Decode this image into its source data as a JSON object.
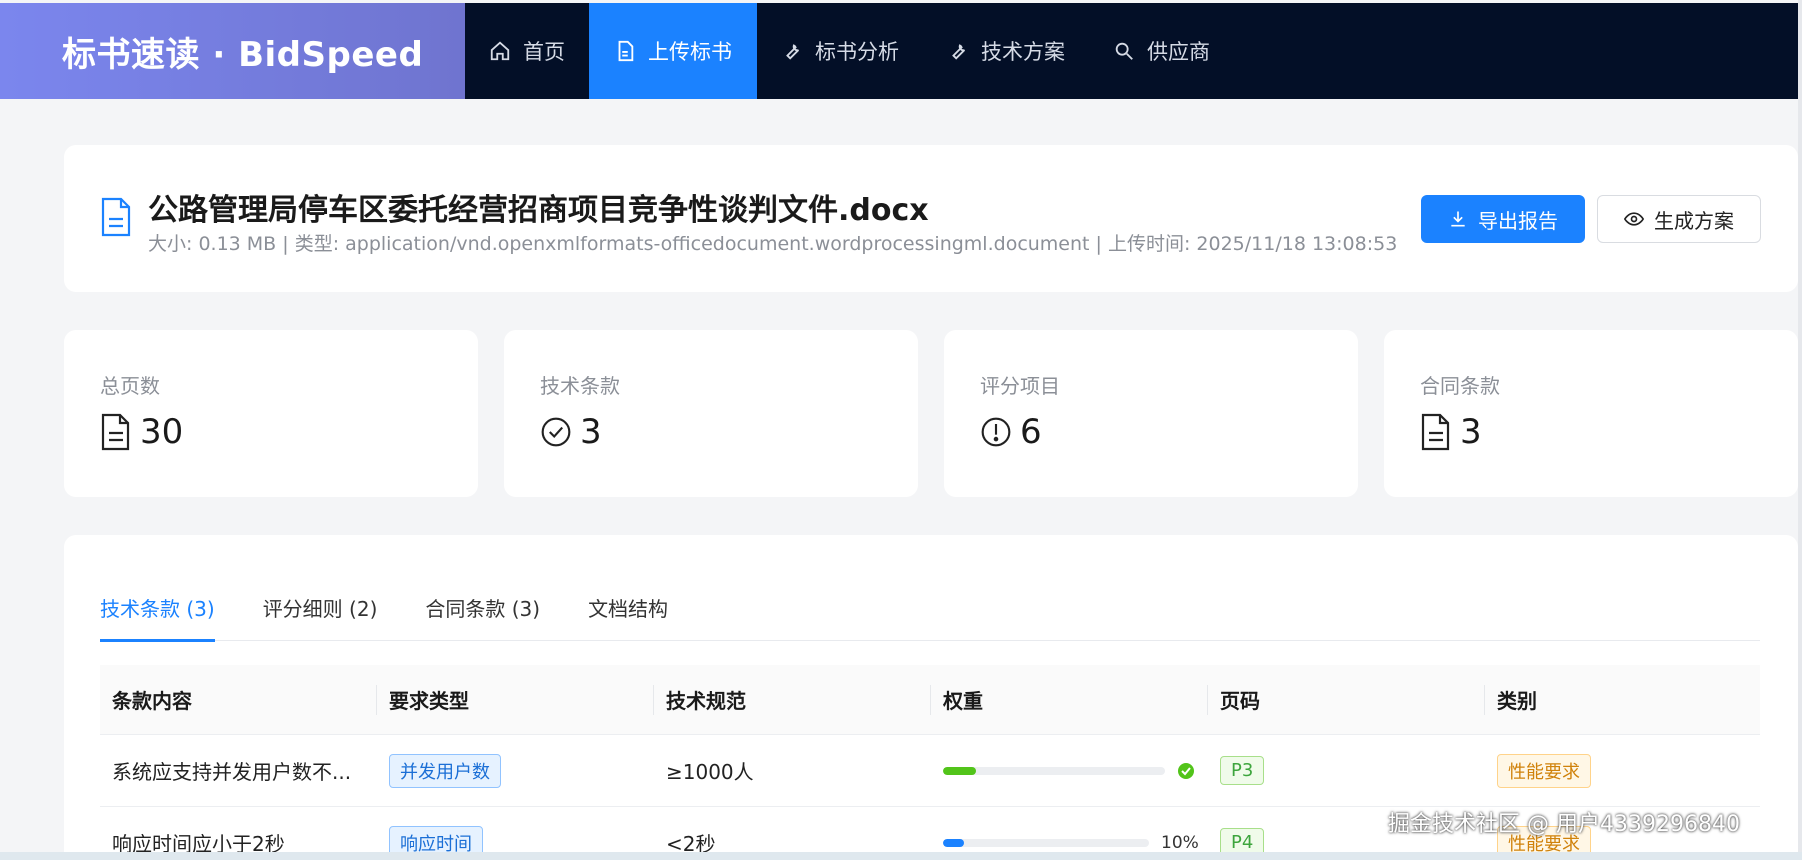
{
  "brand": "标书速读 · BidSpeed",
  "nav": [
    {
      "label": "首页",
      "icon": "home-icon"
    },
    {
      "label": "上传标书",
      "icon": "document-icon",
      "active": true
    },
    {
      "label": "标书分析",
      "icon": "wrench-icon"
    },
    {
      "label": "技术方案",
      "icon": "wrench-icon"
    },
    {
      "label": "供应商",
      "icon": "search-icon"
    }
  ],
  "file": {
    "title": "公路管理局停车区委托经营招商项目竞争性谈判文件.docx",
    "meta": "大小: 0.13 MB | 类型: application/vnd.openxmlformats-officedocument.wordprocessingml.document | 上传时间: 2025/11/18 13:08:53",
    "export_label": "导出报告",
    "generate_label": "生成方案"
  },
  "stats": [
    {
      "label": "总页数",
      "value": "30",
      "icon": "file-text-icon"
    },
    {
      "label": "技术条款",
      "value": "3",
      "icon": "check-circle-icon"
    },
    {
      "label": "评分项目",
      "value": "6",
      "icon": "exclamation-circle-icon"
    },
    {
      "label": "合同条款",
      "value": "3",
      "icon": "file-text-icon"
    }
  ],
  "tabs": [
    {
      "label": "技术条款 (3)",
      "active": true
    },
    {
      "label": "评分细则 (2)"
    },
    {
      "label": "合同条款 (3)"
    },
    {
      "label": "文档结构"
    }
  ],
  "table": {
    "headers": [
      "条款内容",
      "要求类型",
      "技术规范",
      "权重",
      "页码",
      "类别"
    ],
    "rows": [
      {
        "content": "系统应支持并发用户数不...",
        "type": "并发用户数",
        "spec": "≥1000人",
        "weight": 0.15,
        "weight_text": "",
        "status_color": "#52c41a",
        "page": "P3",
        "category": "性能要求"
      },
      {
        "content": "响应时间应小于2秒",
        "type": "响应时间",
        "spec": "<2秒",
        "weight": 0.1,
        "weight_text": "10%",
        "status_color": "#1b82ff",
        "page": "P4",
        "category": "性能要求"
      }
    ]
  },
  "watermark": "掘金技术社区 @ 用户4339296840",
  "colors": {
    "primary": "#1b82ff",
    "nav_bg": "#030f27",
    "success": "#52c41a"
  }
}
